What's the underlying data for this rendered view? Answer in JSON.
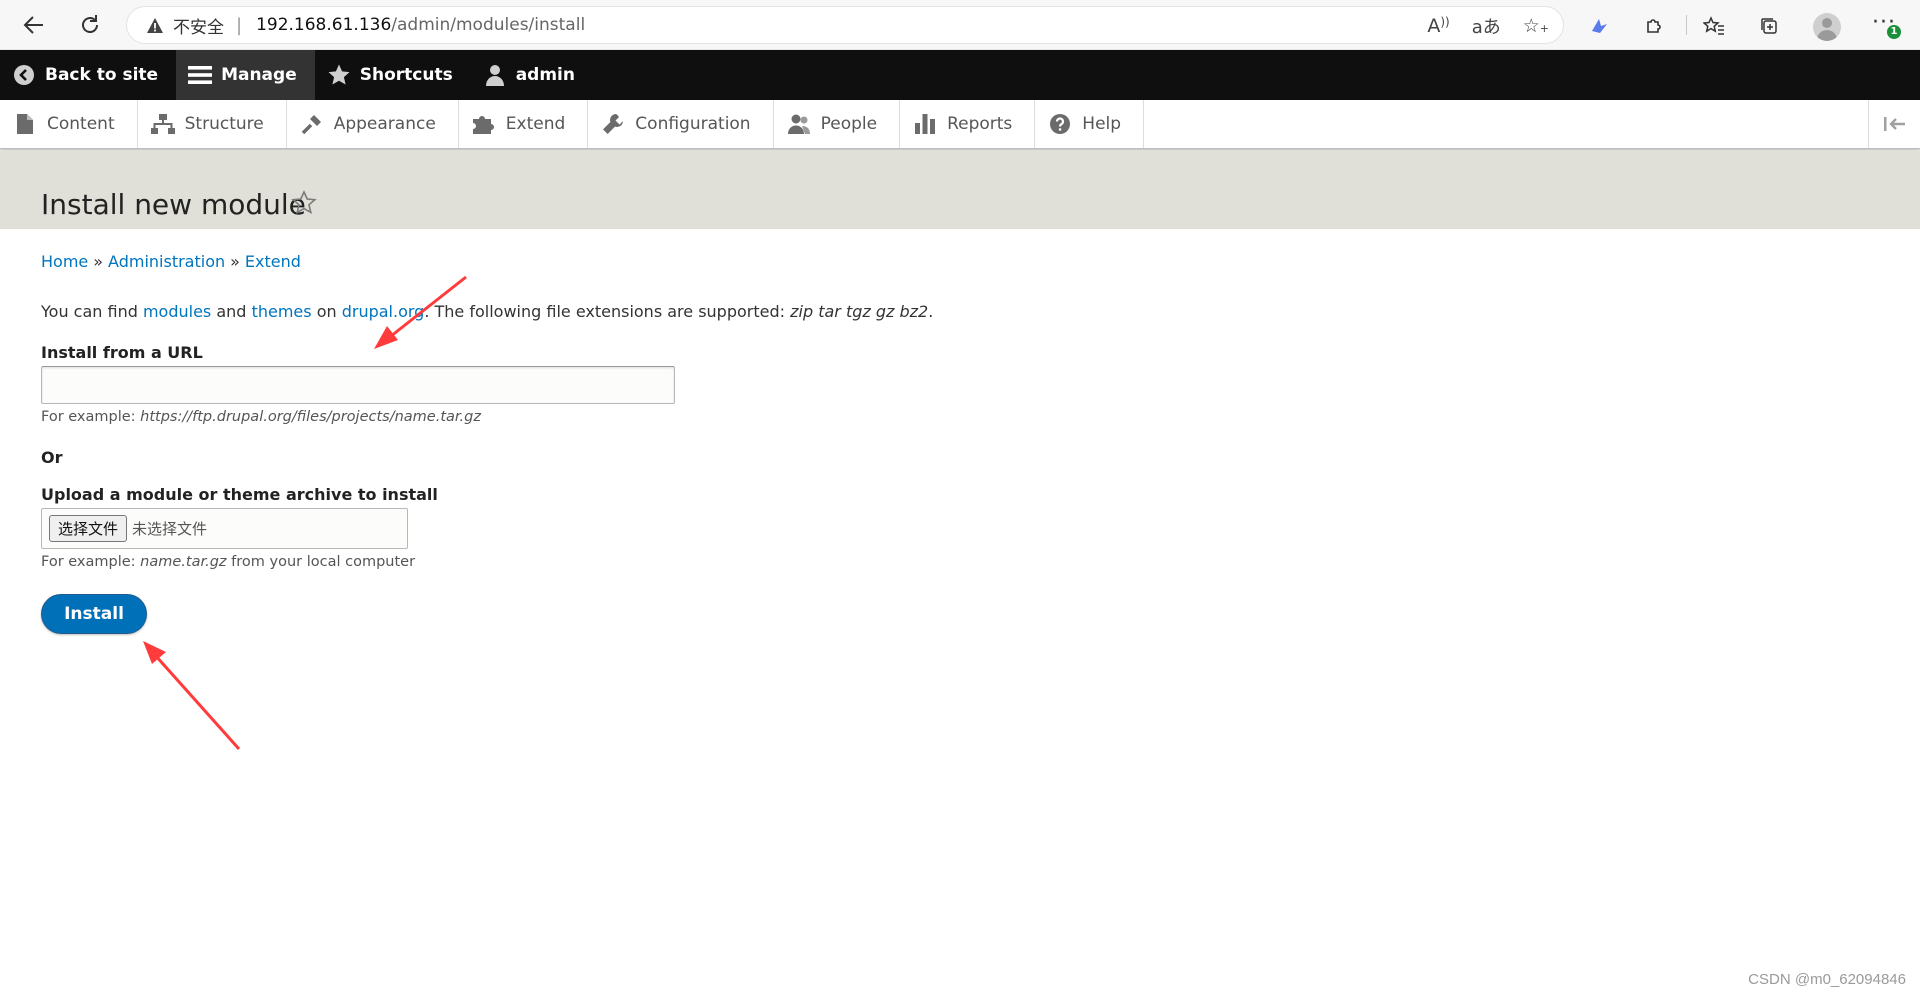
{
  "browser": {
    "insecure_label": "不安全",
    "url_host": "192.168.61.136",
    "url_path": "/admin/modules/install",
    "more_badge": "1"
  },
  "toolbar": {
    "back_to_site": "Back to site",
    "manage": "Manage",
    "shortcuts": "Shortcuts",
    "user": "admin"
  },
  "tray": {
    "items": [
      {
        "label": "Content",
        "icon": "file-icon"
      },
      {
        "label": "Structure",
        "icon": "sitemap-icon"
      },
      {
        "label": "Appearance",
        "icon": "paintbrush-icon"
      },
      {
        "label": "Extend",
        "icon": "puzzle-icon"
      },
      {
        "label": "Configuration",
        "icon": "wrench-icon"
      },
      {
        "label": "People",
        "icon": "people-icon"
      },
      {
        "label": "Reports",
        "icon": "bar-chart-icon"
      },
      {
        "label": "Help",
        "icon": "help-icon"
      }
    ]
  },
  "page": {
    "title": "Install new module"
  },
  "breadcrumb": {
    "home": "Home",
    "sep": "»",
    "administration": "Administration",
    "extend": "Extend"
  },
  "intro": {
    "t1": "You can find",
    "modules": "modules",
    "and": "and",
    "themes": "themes",
    "on": "on",
    "drupal": "drupal.org",
    "t2": ". The following file extensions are supported:",
    "extensions": "zip tar tgz gz bz2",
    "end": "."
  },
  "url_field": {
    "label": "Install from a URL",
    "value": "",
    "desc_prefix": "For example:",
    "desc_example": "https://ftp.drupal.org/files/projects/name.tar.gz"
  },
  "or_label": "Or",
  "upload_field": {
    "label": "Upload a module or theme archive to install",
    "button": "选择文件",
    "status": "未选择文件",
    "desc_prefix": "For example:",
    "desc_example": "name.tar.gz",
    "desc_suffix": "from your local computer"
  },
  "install_button": "Install",
  "watermark": "CSDN @m0_62094846",
  "colors": {
    "toolbar_bg": "#0f0f0f",
    "header_bg": "#e0e0d8",
    "link": "#0074bd",
    "button_primary": "#0071b8",
    "annotation_arrow": "#ff3b3b"
  }
}
